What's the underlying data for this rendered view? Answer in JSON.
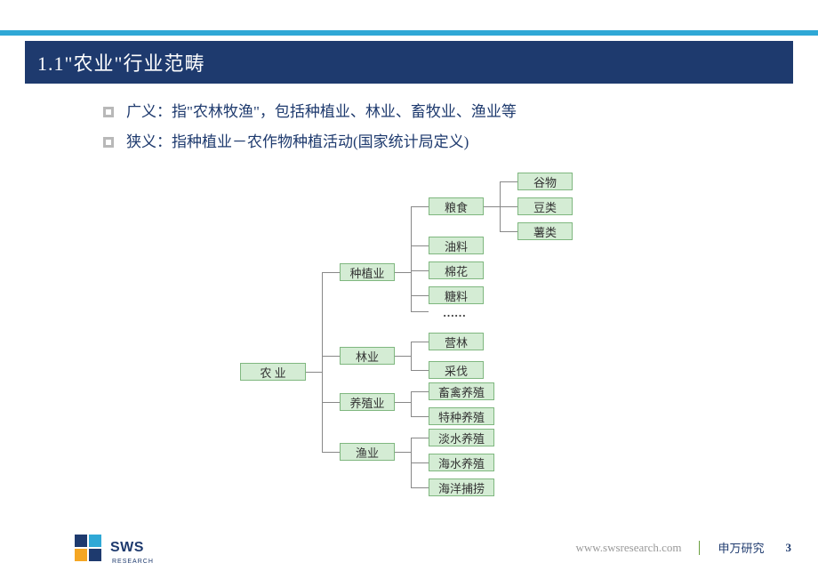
{
  "title": "1.1\"农业\"行业范畴",
  "bullets": [
    "广义：指\"农林牧渔\"，包括种植业、林业、畜牧业、渔业等",
    "狭义：指种植业－农作物种植活动(国家统计局定义)"
  ],
  "tree": {
    "root": "农  业",
    "level2": {
      "planting": "种植业",
      "forestry": "林业",
      "breeding": "养殖业",
      "fishery": "渔业"
    },
    "level3": {
      "grain": "粮食",
      "oil": "油料",
      "cotton": "棉花",
      "sugar": "糖料",
      "ellipsis": "……",
      "silviculture": "营林",
      "logging": "采伐",
      "livestock": "畜禽养殖",
      "special": "特种养殖",
      "freshwater": "淡水养殖",
      "seawater": "海水养殖",
      "marine": "海洋捕捞"
    },
    "level4": {
      "cereal": "谷物",
      "beans": "豆类",
      "tubers": "薯类"
    }
  },
  "footer": {
    "url": "www.swsresearch.com",
    "brand": "申万研究",
    "page": "3",
    "logo_text": "SWS",
    "logo_sub": "RESEARCH"
  }
}
